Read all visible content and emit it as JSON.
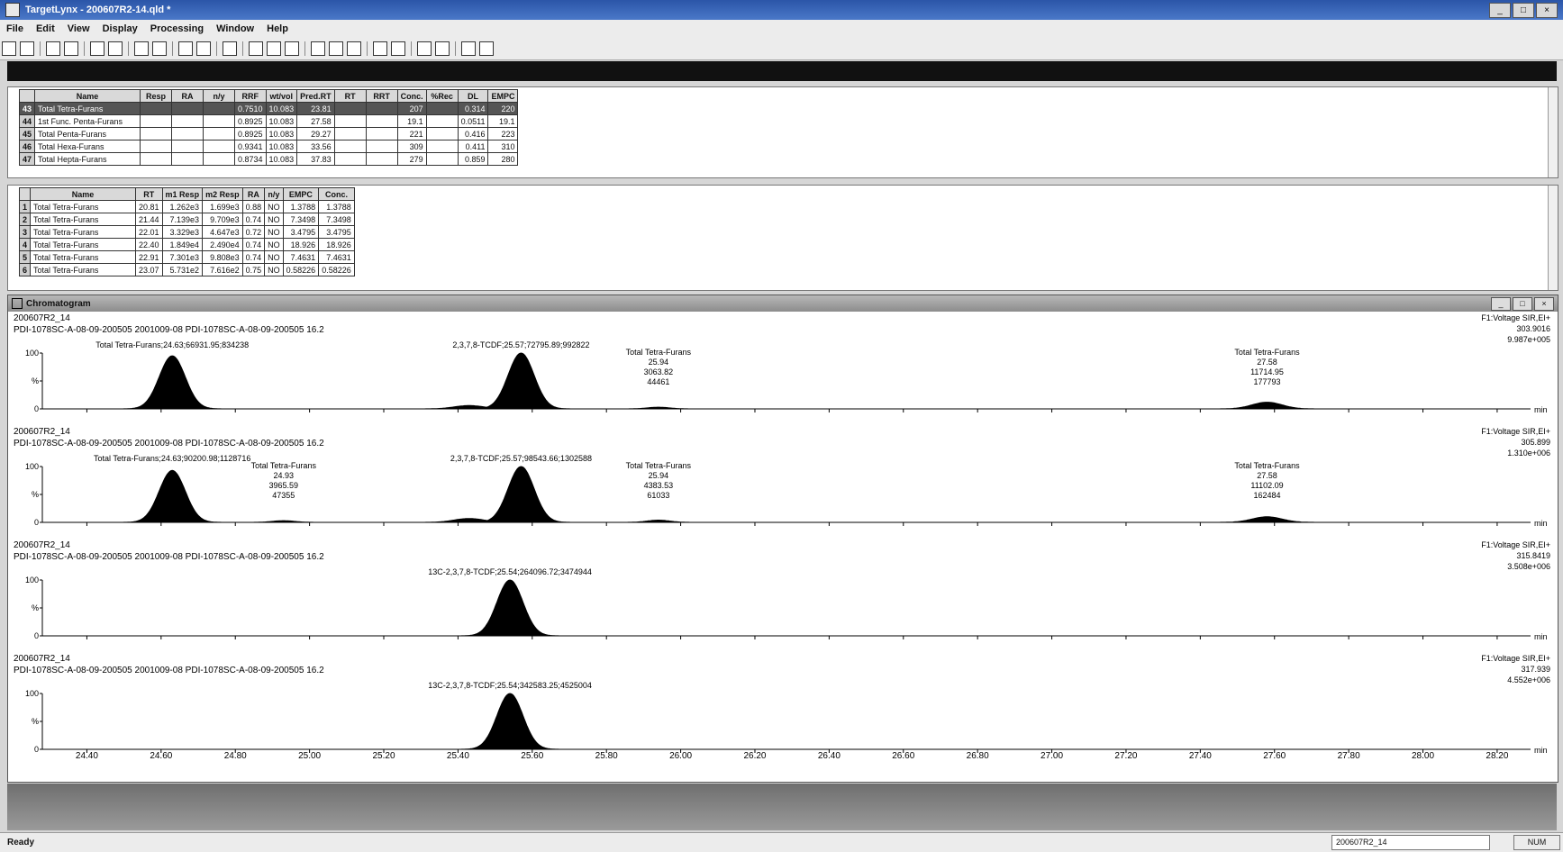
{
  "window": {
    "title": "TargetLynx - 200607R2-14.qld *"
  },
  "menu": [
    "File",
    "Edit",
    "View",
    "Display",
    "Processing",
    "Window",
    "Help"
  ],
  "table1": {
    "headers": [
      "",
      "Name",
      "Resp",
      "RA",
      "n/y",
      "RRF",
      "wt/vol",
      "Pred.RT",
      "RT",
      "RRT",
      "Conc.",
      "%Rec",
      "DL",
      "EMPC"
    ],
    "rows": [
      [
        "43",
        "Total Tetra-Furans",
        "",
        "",
        "",
        "0.7510",
        "10.083",
        "23.81",
        "",
        "",
        "207",
        "",
        "0.314",
        "220"
      ],
      [
        "44",
        "1st Func. Penta-Furans",
        "",
        "",
        "",
        "0.8925",
        "10.083",
        "27.58",
        "",
        "",
        "19.1",
        "",
        "0.0511",
        "19.1"
      ],
      [
        "45",
        "Total Penta-Furans",
        "",
        "",
        "",
        "0.8925",
        "10.083",
        "29.27",
        "",
        "",
        "221",
        "",
        "0.416",
        "223"
      ],
      [
        "46",
        "Total Hexa-Furans",
        "",
        "",
        "",
        "0.9341",
        "10.083",
        "33.56",
        "",
        "",
        "309",
        "",
        "0.411",
        "310"
      ],
      [
        "47",
        "Total Hepta-Furans",
        "",
        "",
        "",
        "0.8734",
        "10.083",
        "37.83",
        "",
        "",
        "279",
        "",
        "0.859",
        "280"
      ]
    ]
  },
  "table2": {
    "headers": [
      "",
      "Name",
      "RT",
      "m1 Resp",
      "m2 Resp",
      "RA",
      "n/y",
      "EMPC",
      "Conc."
    ],
    "rows": [
      [
        "1",
        "Total Tetra-Furans",
        "20.81",
        "1.262e3",
        "1.699e3",
        "0.88",
        "NO",
        "1.3788",
        "1.3788"
      ],
      [
        "2",
        "Total Tetra-Furans",
        "21.44",
        "7.139e3",
        "9.709e3",
        "0.74",
        "NO",
        "7.3498",
        "7.3498"
      ],
      [
        "3",
        "Total Tetra-Furans",
        "22.01",
        "3.329e3",
        "4.647e3",
        "0.72",
        "NO",
        "3.4795",
        "3.4795"
      ],
      [
        "4",
        "Total Tetra-Furans",
        "22.40",
        "1.849e4",
        "2.490e4",
        "0.74",
        "NO",
        "18.926",
        "18.926"
      ],
      [
        "5",
        "Total Tetra-Furans",
        "22.91",
        "7.301e3",
        "9.808e3",
        "0.74",
        "NO",
        "7.4631",
        "7.4631"
      ],
      [
        "6",
        "Total Tetra-Furans",
        "23.07",
        "5.731e2",
        "7.616e2",
        "0.75",
        "NO",
        "0.58226",
        "0.58226"
      ]
    ]
  },
  "chromatogram": {
    "title": "Chromatogram",
    "x_unit": "min",
    "x_ticks": [
      "24.40",
      "24.60",
      "24.80",
      "25.00",
      "25.20",
      "25.40",
      "25.60",
      "25.80",
      "26.00",
      "26.20",
      "26.40",
      "26.60",
      "26.80",
      "27.00",
      "27.20",
      "27.40",
      "27.60",
      "27.80",
      "28.00",
      "28.20"
    ],
    "y_ticks": [
      "100",
      "%",
      "0"
    ],
    "traces": [
      {
        "sample": "200607R2_14",
        "desc": "PDI-1078SC-A-08-09-200505 2001009-08 PDI-1078SC-A-08-09-200505 16.2",
        "func": "F1:Voltage SIR,EI+",
        "mass": "303.9016",
        "max": "9.987e+005",
        "peaks": [
          {
            "rt": 24.63,
            "h": 0.95,
            "w": 0.035
          },
          {
            "rt": 25.43,
            "h": 0.06,
            "w": 0.04
          },
          {
            "rt": 25.57,
            "h": 1.0,
            "w": 0.035
          },
          {
            "rt": 25.94,
            "h": 0.03,
            "w": 0.03
          },
          {
            "rt": 27.58,
            "h": 0.12,
            "w": 0.04
          }
        ],
        "labels": [
          {
            "text": "Total Tetra-Furans;24.63;66931.95;834238",
            "rt": 24.63
          },
          {
            "text": "2,3,7,8-TCDF;25.57;72795.89;992822",
            "rt": 25.57
          },
          {
            "text": "Total Tetra-Furans\n25.94\n3063.82\n44461",
            "rt": 25.94
          },
          {
            "text": "Total Tetra-Furans\n27.58\n11714.95\n177793",
            "rt": 27.58
          }
        ]
      },
      {
        "sample": "200607R2_14",
        "desc": "PDI-1078SC-A-08-09-200505 2001009-08 PDI-1078SC-A-08-09-200505 16.2",
        "func": "F1:Voltage SIR,EI+",
        "mass": "305.899",
        "max": "1.310e+006",
        "peaks": [
          {
            "rt": 24.63,
            "h": 0.93,
            "w": 0.035
          },
          {
            "rt": 24.93,
            "h": 0.03,
            "w": 0.03
          },
          {
            "rt": 25.43,
            "h": 0.07,
            "w": 0.04
          },
          {
            "rt": 25.57,
            "h": 1.0,
            "w": 0.035
          },
          {
            "rt": 25.94,
            "h": 0.04,
            "w": 0.03
          },
          {
            "rt": 27.58,
            "h": 0.1,
            "w": 0.04
          }
        ],
        "labels": [
          {
            "text": "Total Tetra-Furans;24.63;90200.98;1128716",
            "rt": 24.63
          },
          {
            "text": "Total Tetra-Furans\n24.93\n3965.59\n47355",
            "rt": 24.93
          },
          {
            "text": "2,3,7,8-TCDF;25.57;98543.66;1302588",
            "rt": 25.57
          },
          {
            "text": "Total Tetra-Furans\n25.94\n4383.53\n61033",
            "rt": 25.94
          },
          {
            "text": "Total Tetra-Furans\n27.58\n11102.09\n162484",
            "rt": 27.58
          }
        ]
      },
      {
        "sample": "200607R2_14",
        "desc": "PDI-1078SC-A-08-09-200505 2001009-08 PDI-1078SC-A-08-09-200505 16.2",
        "func": "F1:Voltage SIR,EI+",
        "mass": "315.8419",
        "max": "3.508e+006",
        "peaks": [
          {
            "rt": 25.54,
            "h": 1.0,
            "w": 0.035
          }
        ],
        "labels": [
          {
            "text": "13C-2,3,7,8-TCDF;25.54;264096.72;3474944",
            "rt": 25.54
          }
        ]
      },
      {
        "sample": "200607R2_14",
        "desc": "PDI-1078SC-A-08-09-200505 2001009-08 PDI-1078SC-A-08-09-200505 16.2",
        "func": "F1:Voltage SIR,EI+",
        "mass": "317.939",
        "max": "4.552e+006",
        "peaks": [
          {
            "rt": 25.54,
            "h": 1.0,
            "w": 0.035
          }
        ],
        "labels": [
          {
            "text": "13C-2,3,7,8-TCDF;25.54;342583.25;4525004",
            "rt": 25.54
          }
        ]
      }
    ]
  },
  "status": {
    "ready": "Ready",
    "file": "200607R2_14",
    "num": "NUM"
  }
}
